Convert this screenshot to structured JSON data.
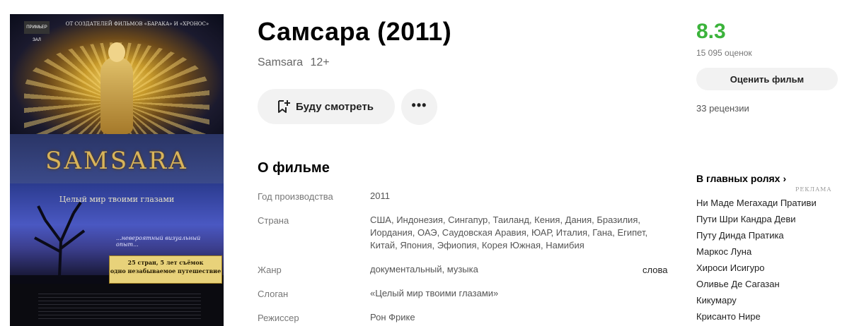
{
  "poster": {
    "badge": "ПРИМЬЕР ЗАЛ",
    "top_text": "ОТ СОЗДАТЕЛЕЙ ФИЛЬМОВ «БАРАКА» И «ХРОНОС»",
    "title": "SAMSARA",
    "slogan": "Целый мир твоими глазами",
    "subline": "...невероятный визуальный опыт...",
    "plate_line1": "25 стран, 5 лет съёмок",
    "plate_line2": "одно незабываемое путешествие"
  },
  "movie": {
    "title": "Самсара (2011)",
    "original_title": "Samsara",
    "age_rating": "12+"
  },
  "actions": {
    "watch_label": "Буду смотреть",
    "more_label": "•••"
  },
  "about": {
    "heading": "О фильме",
    "rows": [
      {
        "label": "Год производства",
        "value": "2011"
      },
      {
        "label": "Страна",
        "value": "США, Индонезия, Сингапур, Таиланд, Кения, Дания, Бразилия, Иордания, ОАЭ, Саудовская Аравия, ЮАР, Италия, Гана, Египет, Китай, Япония, Эфиопия, Корея Южная, Намибия"
      },
      {
        "label": "Жанр",
        "value": "документальный, музыка"
      },
      {
        "label": "Слоган",
        "value": "«Целый мир твоими глазами»"
      },
      {
        "label": "Режиссер",
        "value": "Рон Фрике"
      }
    ],
    "extra": "слова"
  },
  "rating": {
    "value": "8.3",
    "votes": "15 095 оценок",
    "rate_button": "Оценить фильм",
    "reviews": "33 рецензии",
    "color": "#3bb33b"
  },
  "cast": {
    "heading": "В главных ролях",
    "ad_label": "РЕКЛАМА",
    "actors": [
      "Ни Маде Мегахади Пративи",
      "Пути Шри Кандра Деви",
      "Путу Динда Пратика",
      "Маркос Луна",
      "Хироси Исигуро",
      "Оливье Де Сагазан",
      "Кикумару",
      "Крисанто Нире"
    ]
  }
}
